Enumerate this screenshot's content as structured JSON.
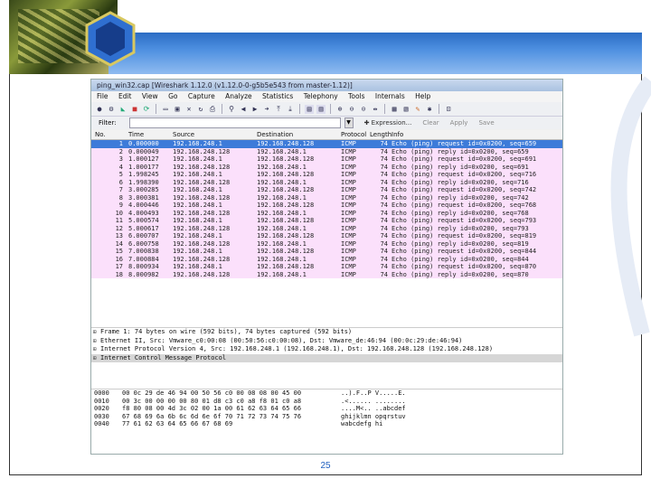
{
  "colors": {
    "accent": "#1f4f9a",
    "selection": "#3d7bd9",
    "row_bg": "#fbe0fb"
  },
  "window": {
    "title": "ping_win32.cap   [Wireshark 1.12.0  (v1.12.0-0-g5b5e543  from master-1.12)]"
  },
  "menu": [
    "File",
    "Edit",
    "View",
    "Go",
    "Capture",
    "Analyze",
    "Statistics",
    "Telephony",
    "Tools",
    "Internals",
    "Help"
  ],
  "toolbar_icons": [
    "list-interfaces-icon",
    "capture-options-icon",
    "start-capture-icon",
    "stop-capture-icon",
    "restart-capture-icon",
    "open-file-icon",
    "save-file-icon",
    "close-file-icon",
    "reload-icon",
    "print-icon",
    "find-icon",
    "go-back-icon",
    "go-forward-icon",
    "go-to-packet-icon",
    "go-first-icon",
    "go-last-icon",
    "colorize-icon",
    "autoscroll-icon",
    "zoom-in-icon",
    "zoom-out-icon",
    "zoom-normal-icon",
    "resize-columns-icon",
    "capture-filters-icon",
    "display-filters-icon",
    "coloring-rules-icon",
    "preferences-icon",
    "help-icon"
  ],
  "filter": {
    "label": "Filter:",
    "value": "",
    "expression": "Expression...",
    "clear": "Clear",
    "apply": "Apply",
    "save": "Save"
  },
  "columns": {
    "no": "No.",
    "time": "Time",
    "source": "Source",
    "destination": "Destination",
    "protocol": "Protocol",
    "length": "Length",
    "info": "Info"
  },
  "packets": [
    {
      "no": "1",
      "time": "0.000000",
      "src": "192.168.248.1",
      "dst": "192.168.248.128",
      "proto": "ICMP",
      "len": "74",
      "info": "Echo (ping) request  id=0x0200, seq=659"
    },
    {
      "no": "2",
      "time": "0.000049",
      "src": "192.168.248.128",
      "dst": "192.168.248.1",
      "proto": "ICMP",
      "len": "74",
      "info": "Echo (ping) reply    id=0x0200, seq=659"
    },
    {
      "no": "3",
      "time": "1.000127",
      "src": "192.168.248.1",
      "dst": "192.168.248.128",
      "proto": "ICMP",
      "len": "74",
      "info": "Echo (ping) request  id=0x0200, seq=691"
    },
    {
      "no": "4",
      "time": "1.000177",
      "src": "192.168.248.128",
      "dst": "192.168.248.1",
      "proto": "ICMP",
      "len": "74",
      "info": "Echo (ping) reply    id=0x0200, seq=691"
    },
    {
      "no": "5",
      "time": "1.998245",
      "src": "192.168.248.1",
      "dst": "192.168.248.128",
      "proto": "ICMP",
      "len": "74",
      "info": "Echo (ping) request  id=0x0200, seq=716"
    },
    {
      "no": "6",
      "time": "1.998390",
      "src": "192.168.248.128",
      "dst": "192.168.248.1",
      "proto": "ICMP",
      "len": "74",
      "info": "Echo (ping) reply    id=0x0200, seq=716"
    },
    {
      "no": "7",
      "time": "3.000285",
      "src": "192.168.248.1",
      "dst": "192.168.248.128",
      "proto": "ICMP",
      "len": "74",
      "info": "Echo (ping) request  id=0x0200, seq=742"
    },
    {
      "no": "8",
      "time": "3.000381",
      "src": "192.168.248.128",
      "dst": "192.168.248.1",
      "proto": "ICMP",
      "len": "74",
      "info": "Echo (ping) reply    id=0x0200, seq=742"
    },
    {
      "no": "9",
      "time": "4.000446",
      "src": "192.168.248.1",
      "dst": "192.168.248.128",
      "proto": "ICMP",
      "len": "74",
      "info": "Echo (ping) request  id=0x0200, seq=768"
    },
    {
      "no": "10",
      "time": "4.000493",
      "src": "192.168.248.128",
      "dst": "192.168.248.1",
      "proto": "ICMP",
      "len": "74",
      "info": "Echo (ping) reply    id=0x0200, seq=768"
    },
    {
      "no": "11",
      "time": "5.000574",
      "src": "192.168.248.1",
      "dst": "192.168.248.128",
      "proto": "ICMP",
      "len": "74",
      "info": "Echo (ping) request  id=0x0200, seq=793"
    },
    {
      "no": "12",
      "time": "5.000617",
      "src": "192.168.248.128",
      "dst": "192.168.248.1",
      "proto": "ICMP",
      "len": "74",
      "info": "Echo (ping) reply    id=0x0200, seq=793"
    },
    {
      "no": "13",
      "time": "6.000707",
      "src": "192.168.248.1",
      "dst": "192.168.248.128",
      "proto": "ICMP",
      "len": "74",
      "info": "Echo (ping) request  id=0x0200, seq=819"
    },
    {
      "no": "14",
      "time": "6.000758",
      "src": "192.168.248.128",
      "dst": "192.168.248.1",
      "proto": "ICMP",
      "len": "74",
      "info": "Echo (ping) reply    id=0x0200, seq=819"
    },
    {
      "no": "15",
      "time": "7.000838",
      "src": "192.168.248.1",
      "dst": "192.168.248.128",
      "proto": "ICMP",
      "len": "74",
      "info": "Echo (ping) request  id=0x0200, seq=844"
    },
    {
      "no": "16",
      "time": "7.000884",
      "src": "192.168.248.128",
      "dst": "192.168.248.1",
      "proto": "ICMP",
      "len": "74",
      "info": "Echo (ping) reply    id=0x0200, seq=844"
    },
    {
      "no": "17",
      "time": "8.000934",
      "src": "192.168.248.1",
      "dst": "192.168.248.128",
      "proto": "ICMP",
      "len": "74",
      "info": "Echo (ping) request  id=0x0200, seq=870"
    },
    {
      "no": "18",
      "time": "8.000982",
      "src": "192.168.248.128",
      "dst": "192.168.248.1",
      "proto": "ICMP",
      "len": "74",
      "info": "Echo (ping) reply    id=0x0200, seq=870"
    }
  ],
  "details": [
    "Frame 1: 74 bytes on wire (592 bits), 74 bytes captured (592 bits)",
    "Ethernet II, Src: Vmware_c0:00:08 (00:50:56:c0:00:08), Dst: Vmware_de:46:94 (00:0c:29:de:46:94)",
    "Internet Protocol Version 4, Src: 192.168.248.1 (192.168.248.1), Dst: 192.168.248.128 (192.168.248.128)",
    "Internet Control Message Protocol"
  ],
  "hex": [
    {
      "off": "0000",
      "bytes": "00 0c 29 de 46 94 00 50  56 c0 00 08 08 00 45 00",
      "ascii": "..).F..P V.....E."
    },
    {
      "off": "0010",
      "bytes": "00 3c 00 00 00 00 80 01  d8 c3 c0 a8 f8 01 c0 a8",
      "ascii": ".<...... ........"
    },
    {
      "off": "0020",
      "bytes": "f8 80 08 00 4d 3c 02 00  1a 00 61 62 63 64 65 66",
      "ascii": "....M<.. ..abcdef"
    },
    {
      "off": "0030",
      "bytes": "67 68 69 6a 6b 6c 6d 6e  6f 70 71 72 73 74 75 76",
      "ascii": "ghijklmn opqrstuv"
    },
    {
      "off": "0040",
      "bytes": "77 61 62 63 64 65 66 67  68 69",
      "ascii": "wabcdefg hi"
    }
  ],
  "slide": {
    "page_number": "25"
  }
}
